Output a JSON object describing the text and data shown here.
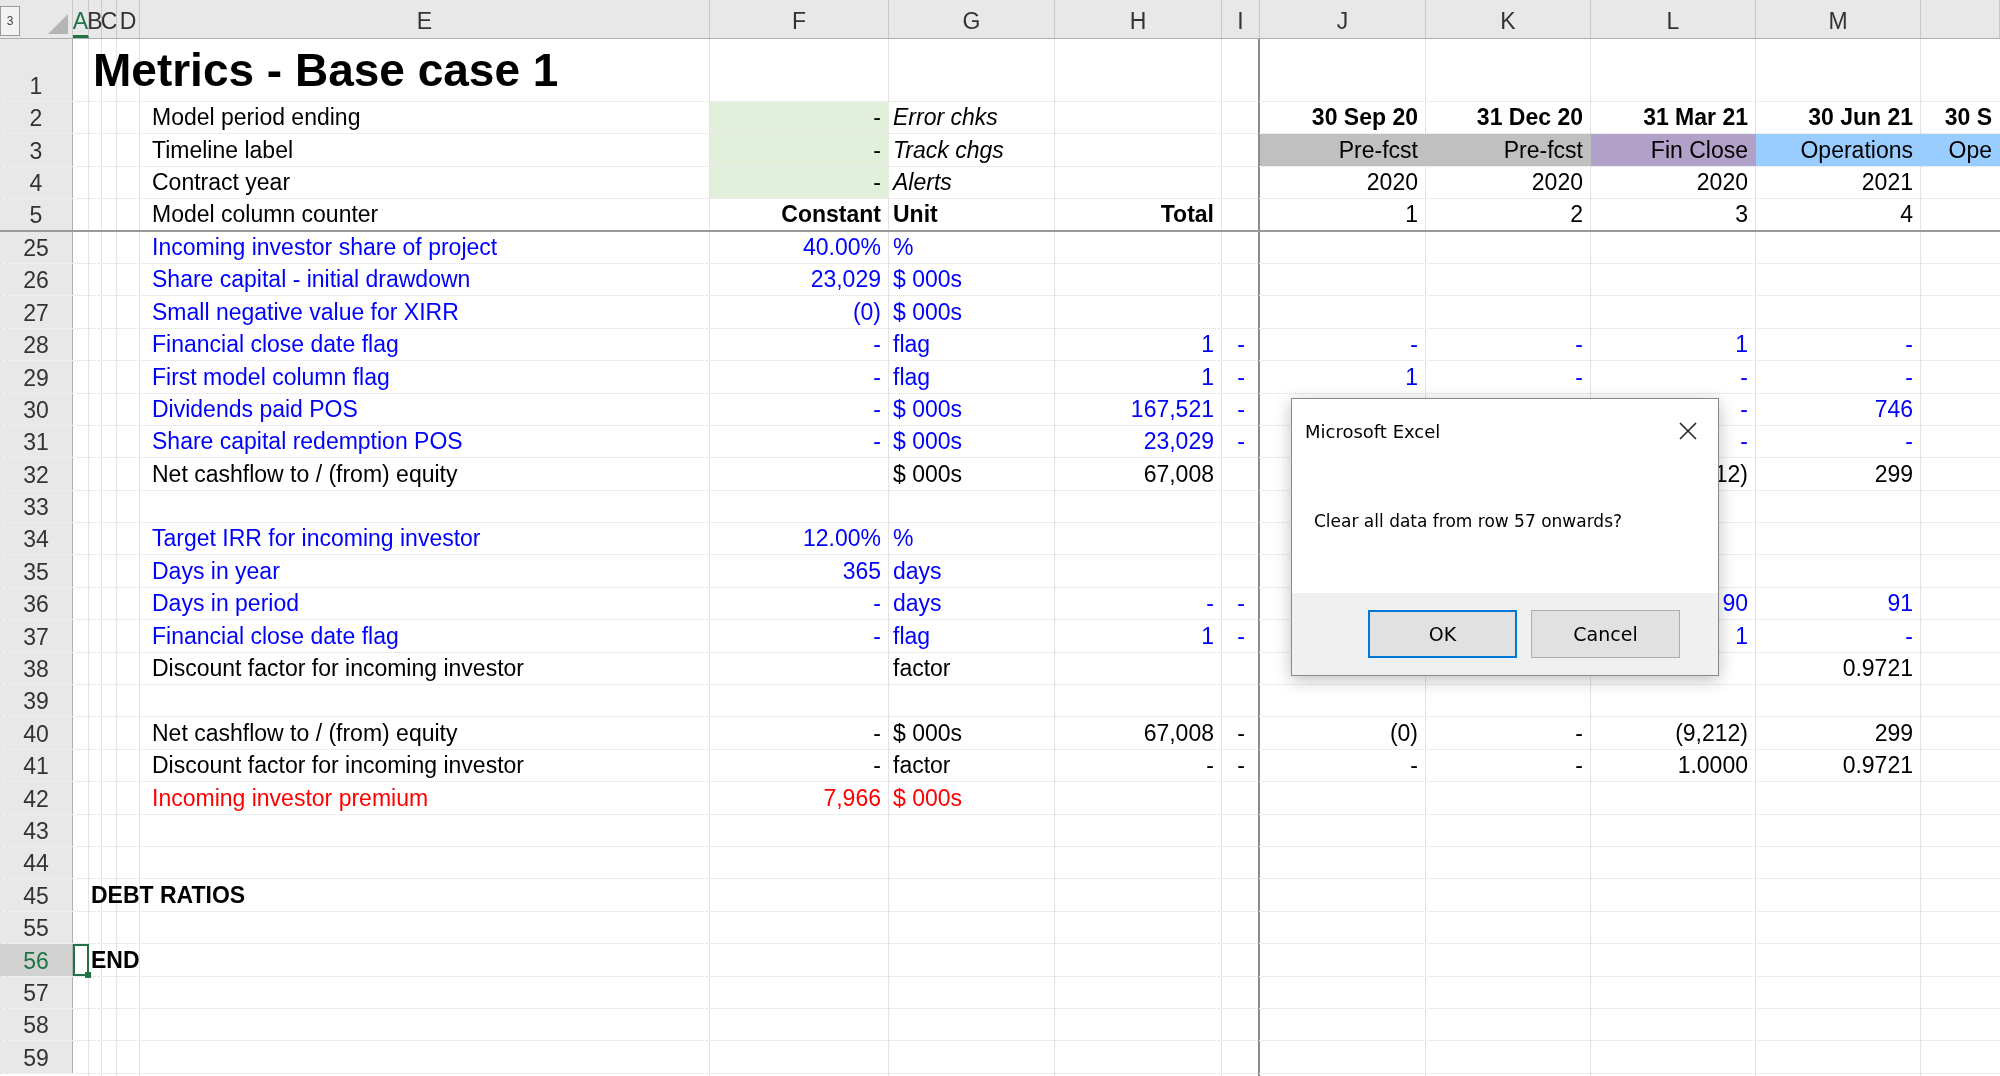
{
  "outline_button": "3",
  "columns": [
    {
      "label": "A",
      "selected": true
    },
    {
      "label": "B",
      "selected": false
    },
    {
      "label": "C",
      "selected": false
    },
    {
      "label": "D",
      "selected": false
    },
    {
      "label": "E",
      "selected": false
    },
    {
      "label": "F",
      "selected": false
    },
    {
      "label": "G",
      "selected": false
    },
    {
      "label": "H",
      "selected": false
    },
    {
      "label": "I",
      "selected": false
    },
    {
      "label": "J",
      "selected": false
    },
    {
      "label": "K",
      "selected": false
    },
    {
      "label": "L",
      "selected": false
    },
    {
      "label": "M",
      "selected": false
    }
  ],
  "rows": [
    {
      "number": "1",
      "selected": false,
      "kind": "title",
      "cells": {
        "b": "Metrics - Base case 1"
      }
    },
    {
      "number": "2",
      "selected": false,
      "kind": "label",
      "cells": {
        "e": "Model period ending",
        "f": {
          "text": "-",
          "color": "#e2efda"
        },
        "g": {
          "text": "Error chks",
          "kind": "italic"
        },
        "j": {
          "text": "30 Sep 20",
          "kind": "bold"
        },
        "k": {
          "text": "31 Dec 20",
          "kind": "bold"
        },
        "l": {
          "text": "31 Mar 21",
          "kind": "bold"
        },
        "m": {
          "text": "30 Jun 21",
          "kind": "bold"
        },
        "n": {
          "text": "30 S",
          "kind": "bold"
        }
      }
    },
    {
      "number": "3",
      "selected": false,
      "kind": "label",
      "cells": {
        "e": "Timeline label",
        "f": {
          "text": "-",
          "color": "#e2efda"
        },
        "g": {
          "text": "Track chgs",
          "kind": "italic"
        },
        "j": {
          "text": "Pre-fcst",
          "color": "#c0c0c0"
        },
        "k": {
          "text": "Pre-fcst",
          "color": "#c0c0c0"
        },
        "l": {
          "text": "Fin Close",
          "color": "#b1a0c7"
        },
        "m": {
          "text": "Operations",
          "color": "#99ccff"
        },
        "n": {
          "text": "Ope",
          "color": "#99ccff"
        }
      }
    },
    {
      "number": "4",
      "selected": false,
      "kind": "label",
      "cells": {
        "e": "Contract year",
        "f": {
          "text": "-",
          "color": "#e2efda"
        },
        "g": {
          "text": "Alerts",
          "kind": "italic"
        },
        "j": "2020",
        "k": "2020",
        "l": "2020",
        "m": "2021"
      }
    },
    {
      "number": "5",
      "selected": false,
      "kind": "label",
      "cells": {
        "e": "Model column counter",
        "f": {
          "text": "Constant",
          "kind": "bold"
        },
        "g": {
          "text": "Unit",
          "kind": "bold"
        },
        "h": {
          "text": "Total",
          "kind": "bold"
        },
        "j": "1",
        "k": "2",
        "l": "3",
        "m": "4"
      }
    },
    {
      "number": "25",
      "selected": false,
      "kind": "input",
      "cells": {
        "e": "Incoming investor share of project",
        "f": "40.00%",
        "g": "%"
      }
    },
    {
      "number": "26",
      "selected": false,
      "kind": "input",
      "cells": {
        "e": "Share capital - initial drawdown",
        "f": "23,029",
        "g": "$ 000s"
      }
    },
    {
      "number": "27",
      "selected": false,
      "kind": "input",
      "cells": {
        "e": "Small negative value for XIRR",
        "f": "(0)",
        "g": "$ 000s"
      }
    },
    {
      "number": "28",
      "selected": false,
      "kind": "input",
      "cells": {
        "e": "Financial close date flag",
        "f": "-",
        "g": "flag",
        "h": "1",
        "i": "-",
        "j": "-",
        "k": "-",
        "l": "1",
        "m": "-"
      }
    },
    {
      "number": "29",
      "selected": false,
      "kind": "input",
      "cells": {
        "e": "First model column flag",
        "f": "-",
        "g": "flag",
        "h": "1",
        "i": "-",
        "j": "1",
        "k": "-",
        "l": "-",
        "m": "-"
      }
    },
    {
      "number": "30",
      "selected": false,
      "kind": "input",
      "cells": {
        "e": "Dividends paid POS",
        "f": "-",
        "g": "$ 000s",
        "h": "167,521",
        "i": "-",
        "l": "-",
        "m": "746"
      }
    },
    {
      "number": "31",
      "selected": false,
      "kind": "input",
      "cells": {
        "e": "Share capital redemption POS",
        "f": "-",
        "g": "$ 000s",
        "h": "23,029",
        "i": "-",
        "l": "-",
        "m": "-"
      }
    },
    {
      "number": "32",
      "selected": false,
      "kind": "calc",
      "cells": {
        "e": "Net cashflow to / (from) equity",
        "g": "$ 000s",
        "h": "67,008",
        "l": "12)",
        "m": "299"
      }
    },
    {
      "number": "33",
      "selected": false,
      "kind": "calc"
    },
    {
      "number": "34",
      "selected": false,
      "kind": "input",
      "cells": {
        "e": "Target IRR for incoming investor",
        "f": "12.00%",
        "g": "%"
      }
    },
    {
      "number": "35",
      "selected": false,
      "kind": "input",
      "cells": {
        "e": "Days in year",
        "f": "365",
        "g": "days"
      }
    },
    {
      "number": "36",
      "selected": false,
      "kind": "input",
      "cells": {
        "e": "Days in period",
        "f": "-",
        "g": "days",
        "h": "-",
        "i": "-",
        "l": "90",
        "m": "91"
      }
    },
    {
      "number": "37",
      "selected": false,
      "kind": "input",
      "cells": {
        "e": "Financial close date flag",
        "f": "-",
        "g": "flag",
        "h": "1",
        "i": "-",
        "l": "1",
        "m": "-"
      }
    },
    {
      "number": "38",
      "selected": false,
      "kind": "calc",
      "cells": {
        "e": "Discount factor for incoming investor",
        "g": "factor",
        "m": "0.9721"
      }
    },
    {
      "number": "39",
      "selected": false,
      "kind": "calc"
    },
    {
      "number": "40",
      "selected": false,
      "kind": "calc",
      "cells": {
        "e": "Net cashflow to / (from) equity",
        "f": "-",
        "g": "$ 000s",
        "h": "67,008",
        "i": "-",
        "j": "(0)",
        "k": "-",
        "l": "(9,212)",
        "m": "299"
      }
    },
    {
      "number": "41",
      "selected": false,
      "kind": "calc",
      "cells": {
        "e": "Discount factor for incoming investor",
        "f": "-",
        "g": "factor",
        "h": "-",
        "i": "-",
        "j": "-",
        "k": "-",
        "l": "1.0000",
        "m": "0.9721"
      }
    },
    {
      "number": "42",
      "selected": false,
      "kind": "alert",
      "cells": {
        "e": "Incoming investor premium",
        "f": "7,966",
        "g": "$ 000s"
      }
    },
    {
      "number": "43",
      "selected": false,
      "kind": "calc"
    },
    {
      "number": "44",
      "selected": false,
      "kind": "calc"
    },
    {
      "number": "45",
      "selected": false,
      "kind": "heading",
      "cells": {
        "a": "DEBT RATIOS"
      }
    },
    {
      "number": "55",
      "selected": false,
      "kind": "calc"
    },
    {
      "number": "56",
      "selected": true,
      "kind": "heading",
      "cells": {
        "a": "END"
      }
    },
    {
      "number": "57",
      "selected": false,
      "kind": "calc"
    },
    {
      "number": "58",
      "selected": false,
      "kind": "calc"
    },
    {
      "number": "59",
      "selected": false,
      "kind": "calc"
    }
  ],
  "dialog": {
    "title": "Microsoft Excel",
    "message": "Clear all data from row 57 onwards?",
    "buttons": [
      {
        "label": "OK",
        "default": true
      },
      {
        "label": "Cancel",
        "default": false
      }
    ]
  }
}
